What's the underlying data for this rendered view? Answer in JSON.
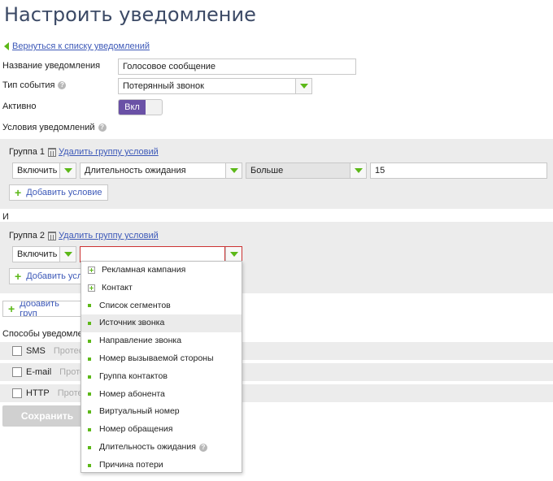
{
  "page": {
    "title": "Настроить уведомление",
    "back_link": "Вернуться к списку уведомлений"
  },
  "form": {
    "name_label": "Название уведомления",
    "name_value": "Голосовое сообщение",
    "event_label": "Тип события",
    "event_value": "Потерянный звонок",
    "active_label": "Активно",
    "active_toggle": "Вкл",
    "conditions_label": "Условия уведомлений"
  },
  "group1": {
    "label": "Группа 1",
    "delete_link": "Удалить группу условий",
    "include": "Включить",
    "field": "Длительность ожидания",
    "operator": "Больше",
    "value": "15",
    "add_condition": "Добавить условие"
  },
  "and_label": "И",
  "group2": {
    "label": "Группа 2",
    "delete_link": "Удалить группу условий",
    "include": "Включить",
    "field": "",
    "add_condition": "Добавить усл"
  },
  "add_group": "Добавить груп",
  "methods": {
    "label": "Способы уведомлен",
    "items": [
      {
        "name": "SMS",
        "test": "Протес"
      },
      {
        "name": "E-mail",
        "test": "Протес"
      },
      {
        "name": "HTTP",
        "test": "Протес"
      }
    ]
  },
  "save_button": "Сохранить",
  "dropdown": {
    "items": [
      {
        "label": "Рекламная кампания",
        "kind": "expand"
      },
      {
        "label": "Контакт",
        "kind": "expand"
      },
      {
        "label": "Список сегментов",
        "kind": "bullet"
      },
      {
        "label": "Источник звонка",
        "kind": "bullet",
        "highlighted": true
      },
      {
        "label": "Направление звонка",
        "kind": "bullet"
      },
      {
        "label": "Номер вызываемой стороны",
        "kind": "bullet"
      },
      {
        "label": "Группа контактов",
        "kind": "bullet"
      },
      {
        "label": "Номер абонента",
        "kind": "bullet"
      },
      {
        "label": "Виртуальный номер",
        "kind": "bullet"
      },
      {
        "label": "Номер обращения",
        "kind": "bullet"
      },
      {
        "label": "Длительность ожидания",
        "kind": "bullet",
        "help": true
      },
      {
        "label": "Причина потери",
        "kind": "bullet"
      }
    ]
  },
  "colors": {
    "accent": "#5cb818",
    "toggle": "#6a51a6",
    "link": "#3d59b8",
    "error_border": "#cc3333"
  }
}
